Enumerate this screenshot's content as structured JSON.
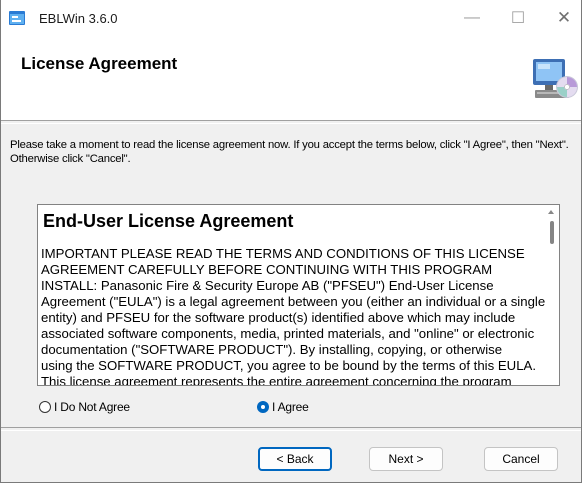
{
  "window": {
    "title": "EBLWin 3.6.0",
    "minimize_glyph": "—",
    "maximize_glyph": "☐",
    "close_glyph": "✕"
  },
  "banner": {
    "title": "License Agreement",
    "icon": "computer-cd-icon"
  },
  "instructions": "Please take a moment to read the license agreement now. If you accept the terms below, click \"I Agree\", then \"Next\". Otherwise click \"Cancel\".",
  "eula": {
    "heading": "End-User License Agreement",
    "lines": [
      "IMPORTANT PLEASE READ THE TERMS AND CONDITIONS OF THIS LICENSE",
      "AGREEMENT CAREFULLY BEFORE CONTINUING WITH THIS PROGRAM",
      "INSTALL: Panasonic Fire & Security Europe AB (\"PFSEU\") End-User License",
      "Agreement (\"EULA\") is a legal agreement between you (either an individual or a single",
      "entity) and PFSEU for the software product(s) identified above which may include",
      "associated software components, media, printed materials, and \"online\" or electronic",
      "documentation (\"SOFTWARE PRODUCT\"). By installing, copying, or otherwise",
      "using the SOFTWARE PRODUCT, you agree to be bound by the terms of this EULA.",
      "This license agreement represents the entire agreement concerning the program"
    ]
  },
  "options": {
    "disagree_label": "I Do Not Agree",
    "agree_label": "I Agree",
    "selected": "agree"
  },
  "buttons": {
    "back": "< Back",
    "next": "Next >",
    "cancel": "Cancel"
  },
  "colors": {
    "accent": "#0067c0"
  }
}
